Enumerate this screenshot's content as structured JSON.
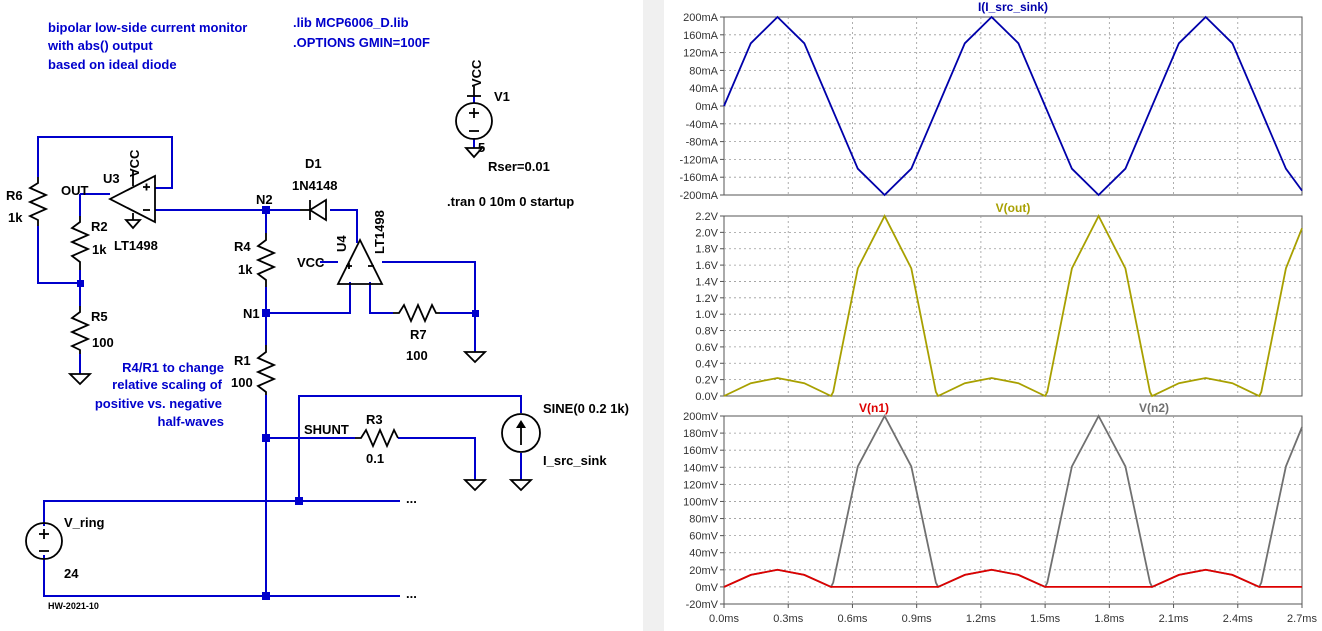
{
  "schematic": {
    "notes": {
      "title_lines": [
        "bipolar low-side current monitor",
        "with abs() output",
        "based on ideal diode"
      ],
      "directives": [
        ".lib MCP6006_D.lib",
        ".OPTIONS GMIN=100F"
      ],
      "tran": ".tran 0 10m 0 startup",
      "scaling_lines": [
        "R4/R1 to change",
        "relative scaling of",
        "positive vs. negative",
        "half-waves"
      ],
      "footer": "HW-2021-10"
    },
    "components": {
      "r6_name": "R6",
      "r6_val": "1k",
      "r2_name": "R2",
      "r2_val": "1k",
      "r5_name": "R5",
      "r5_val": "100",
      "r4_name": "R4",
      "r4_val": "1k",
      "r1_name": "R1",
      "r1_val": "100",
      "r7_name": "R7",
      "r7_val": "100",
      "r3_name": "R3",
      "r3_val": "0.1",
      "u3_name": "U3",
      "u3_model": "LT1498",
      "u3_vcc": "VCC",
      "u4_name": "U4",
      "u4_model": "LT1498",
      "u4_vcc": "VCC",
      "d1_name": "D1",
      "d1_model": "1N4148",
      "v1_name": "V1",
      "v1_net": "VCC",
      "v1_val": "5",
      "v1_rser": "Rser=0.01",
      "vring_name": "V_ring",
      "vring_val": "24",
      "isrc_name": "I_src_sink",
      "isrc_val": "SINE(0 0.2 1k)"
    },
    "nets": {
      "out": "OUT",
      "n1": "N1",
      "n2": "N2",
      "shunt": "SHUNT",
      "cont1": "...",
      "cont2": "..."
    }
  },
  "plots": {
    "panels": [
      {
        "titles": [
          {
            "text": "I(I_src_sink)",
            "color": "#0000aa"
          }
        ],
        "yticks": [
          "200mA",
          "160mA",
          "120mA",
          "80mA",
          "40mA",
          "0mA",
          "-40mA",
          "-80mA",
          "-120mA",
          "-160mA",
          "-200mA"
        ]
      },
      {
        "titles": [
          {
            "text": "V(out)",
            "color": "#a8a000"
          }
        ],
        "yticks": [
          "2.2V",
          "2.0V",
          "1.8V",
          "1.6V",
          "1.4V",
          "1.2V",
          "1.0V",
          "0.8V",
          "0.6V",
          "0.4V",
          "0.2V",
          "0.0V"
        ]
      },
      {
        "titles": [
          {
            "text": "V(n1)",
            "color": "#dd0000"
          },
          {
            "text": "V(n2)",
            "color": "#707070"
          }
        ],
        "yticks": [
          "200mV",
          "180mV",
          "160mV",
          "140mV",
          "120mV",
          "100mV",
          "80mV",
          "60mV",
          "40mV",
          "20mV",
          "0mV",
          "-20mV"
        ]
      }
    ],
    "xticks": [
      "0.0ms",
      "0.3ms",
      "0.6ms",
      "0.9ms",
      "1.2ms",
      "1.5ms",
      "1.8ms",
      "2.1ms",
      "2.4ms",
      "2.7ms"
    ],
    "colors": {
      "current": "#0000aa",
      "vout": "#a8a000",
      "vn1": "#dd0000",
      "vn2": "#707070"
    }
  },
  "chart_data": [
    {
      "type": "line",
      "x_unit": "ms",
      "xlim": [
        0,
        2.7
      ],
      "ylim": [
        -200,
        200
      ],
      "y_unit": "mA",
      "series": [
        {
          "name": "I(I_src_sink)",
          "description": "sine 200mA amplitude, 1kHz",
          "x": [
            0,
            0.125,
            0.25,
            0.375,
            0.5,
            0.625,
            0.75,
            0.875,
            1.0,
            1.125,
            1.25,
            1.375,
            1.5,
            1.625,
            1.75,
            1.875,
            2.0,
            2.125,
            2.25,
            2.375,
            2.5,
            2.625,
            2.7
          ],
          "y": [
            0,
            141,
            200,
            141,
            0,
            -141,
            -200,
            -141,
            0,
            141,
            200,
            141,
            0,
            -141,
            -200,
            -141,
            0,
            141,
            200,
            141,
            0,
            -141,
            -190
          ]
        }
      ]
    },
    {
      "type": "line",
      "x_unit": "ms",
      "xlim": [
        0,
        2.7
      ],
      "ylim": [
        0,
        2.2
      ],
      "y_unit": "V",
      "series": [
        {
          "name": "V(out)",
          "x": [
            0,
            0.125,
            0.25,
            0.375,
            0.5,
            0.51,
            0.625,
            0.75,
            0.875,
            0.99,
            1.0,
            1.125,
            1.25,
            1.375,
            1.5,
            1.51,
            1.625,
            1.75,
            1.875,
            1.99,
            2.0,
            2.125,
            2.25,
            2.375,
            2.5,
            2.51,
            2.625,
            2.7
          ],
          "y": [
            0,
            0.156,
            0.22,
            0.156,
            0,
            0.05,
            1.56,
            2.2,
            1.56,
            0.05,
            0,
            0.156,
            0.22,
            0.156,
            0,
            0.05,
            1.56,
            2.2,
            1.56,
            0.05,
            0,
            0.156,
            0.22,
            0.156,
            0,
            0.05,
            1.56,
            2.05
          ]
        }
      ]
    },
    {
      "type": "line",
      "x_unit": "ms",
      "xlim": [
        0,
        2.7
      ],
      "ylim": [
        -20,
        200
      ],
      "y_unit": "mV",
      "series": [
        {
          "name": "V(n1)",
          "x": [
            0,
            0.125,
            0.25,
            0.375,
            0.5,
            1.0,
            1.125,
            1.25,
            1.375,
            1.5,
            2.0,
            2.125,
            2.25,
            2.375,
            2.5,
            2.7
          ],
          "y": [
            0,
            14,
            20,
            14,
            0,
            0,
            14,
            20,
            14,
            0,
            0,
            14,
            20,
            14,
            0,
            0
          ]
        },
        {
          "name": "V(n2)",
          "x": [
            0,
            0.125,
            0.25,
            0.375,
            0.5,
            0.51,
            0.625,
            0.75,
            0.875,
            0.99,
            1.0,
            1.125,
            1.25,
            1.375,
            1.5,
            1.51,
            1.625,
            1.75,
            1.875,
            1.99,
            2.0,
            2.125,
            2.25,
            2.375,
            2.5,
            2.51,
            2.625,
            2.7
          ],
          "y": [
            0,
            14,
            20,
            14,
            0,
            5,
            141,
            200,
            141,
            5,
            0,
            14,
            20,
            14,
            0,
            5,
            141,
            200,
            141,
            5,
            0,
            14,
            20,
            14,
            0,
            5,
            141,
            187
          ]
        }
      ]
    }
  ]
}
